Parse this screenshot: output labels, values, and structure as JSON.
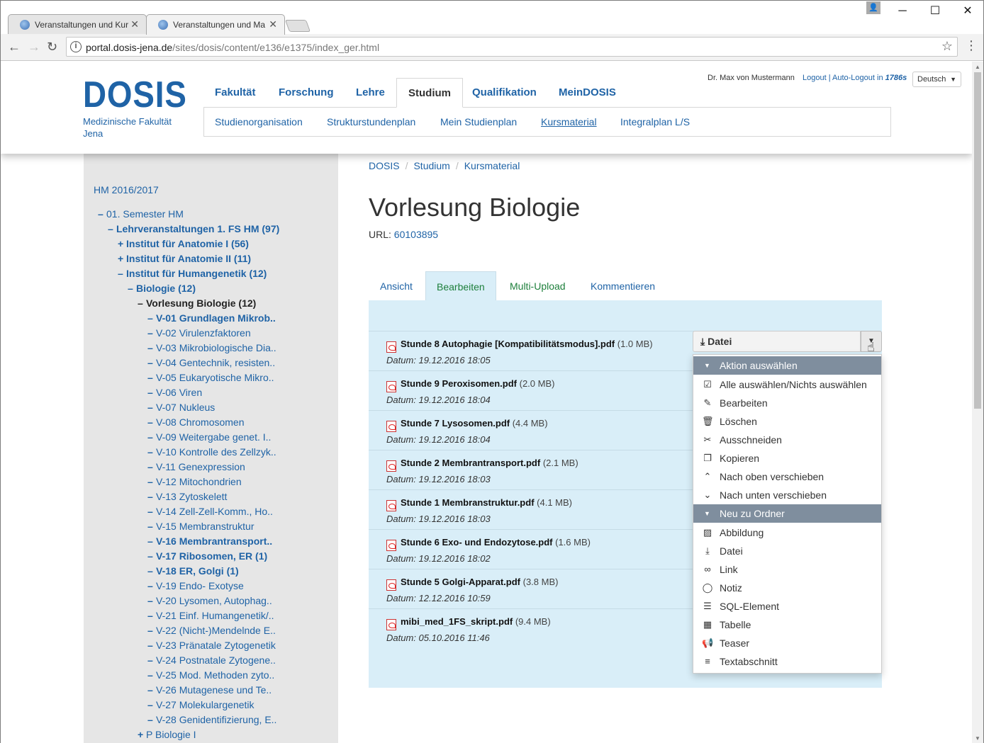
{
  "browser": {
    "tabs": [
      {
        "title": "Veranstaltungen und Kur",
        "active": false
      },
      {
        "title": "Veranstaltungen und Ma",
        "active": true
      }
    ],
    "url_host": "portal.dosis-jena.de",
    "url_path": "/sites/dosis/content/e136/e1375/index_ger.html"
  },
  "header": {
    "logo": "DOSIS",
    "logo_sub1": "Medizinische Fakultät",
    "logo_sub2": "Jena",
    "main_nav": [
      "Fakultät",
      "Forschung",
      "Lehre",
      "Studium",
      "Qualifikation",
      "MeinDOSIS"
    ],
    "sub_nav": [
      "Studienorganisation",
      "Strukturstundenplan",
      "Mein Studienplan",
      "Kursmaterial",
      "Integralplan L/S"
    ],
    "user_name": "Dr. Max von Mustermann",
    "logout": "Logout | Auto-Logout in",
    "logout_seconds": "1786s",
    "language": "Deutsch"
  },
  "sidebar": {
    "year": "HM 2016/2017",
    "tree": [
      {
        "sign": "–",
        "label": "01. Semester HM",
        "level": 0,
        "bold": false
      },
      {
        "sign": "–",
        "label": "Lehrveranstaltungen 1. FS HM (97)",
        "level": 1,
        "bold": true
      },
      {
        "sign": "+",
        "label": "Institut für Anatomie I (56)",
        "level": 2,
        "bold": true
      },
      {
        "sign": "+",
        "label": "Institut für Anatomie II (11)",
        "level": 2,
        "bold": true
      },
      {
        "sign": "–",
        "label": "Institut für Humangenetik (12)",
        "level": 2,
        "bold": true
      },
      {
        "sign": "–",
        "label": "Biologie (12)",
        "level": 3,
        "bold": true
      },
      {
        "sign": "–",
        "label": "Vorlesung Biologie (12)",
        "level": 4,
        "bold": true,
        "current": true
      },
      {
        "sign": "–",
        "label": "V-01 Grundlagen Mikrob..",
        "level": 5,
        "bold": true
      },
      {
        "sign": "–",
        "label": "V-02 Virulenzfaktoren",
        "level": 5,
        "bold": false
      },
      {
        "sign": "–",
        "label": "V-03 Mikrobiologische Dia..",
        "level": 5,
        "bold": false
      },
      {
        "sign": "–",
        "label": "V-04 Gentechnik, resisten..",
        "level": 5,
        "bold": false
      },
      {
        "sign": "–",
        "label": "V-05 Eukaryotische Mikro..",
        "level": 5,
        "bold": false
      },
      {
        "sign": "–",
        "label": "V-06 Viren",
        "level": 5,
        "bold": false
      },
      {
        "sign": "–",
        "label": "V-07 Nukleus",
        "level": 5,
        "bold": false
      },
      {
        "sign": "–",
        "label": "V-08 Chromosomen",
        "level": 5,
        "bold": false
      },
      {
        "sign": "–",
        "label": "V-09 Weitergabe genet. I..",
        "level": 5,
        "bold": false
      },
      {
        "sign": "–",
        "label": "V-10 Kontrolle des Zellzyk..",
        "level": 5,
        "bold": false
      },
      {
        "sign": "–",
        "label": "V-11 Genexpression",
        "level": 5,
        "bold": false
      },
      {
        "sign": "–",
        "label": "V-12 Mitochondrien",
        "level": 5,
        "bold": false
      },
      {
        "sign": "–",
        "label": "V-13 Zytoskelett",
        "level": 5,
        "bold": false
      },
      {
        "sign": "–",
        "label": "V-14 Zell-Zell-Komm., Ho..",
        "level": 5,
        "bold": false
      },
      {
        "sign": "–",
        "label": "V-15 Membranstruktur",
        "level": 5,
        "bold": false
      },
      {
        "sign": "–",
        "label": "V-16 Membrantransport..",
        "level": 5,
        "bold": true
      },
      {
        "sign": "–",
        "label": "V-17 Ribosomen, ER (1)",
        "level": 5,
        "bold": true
      },
      {
        "sign": "–",
        "label": "V-18 ER, Golgi (1)",
        "level": 5,
        "bold": true
      },
      {
        "sign": "–",
        "label": "V-19 Endo- Exotyse",
        "level": 5,
        "bold": false
      },
      {
        "sign": "–",
        "label": "V-20 Lysomen, Autophag..",
        "level": 5,
        "bold": false
      },
      {
        "sign": "–",
        "label": "V-21 Einf. Humangenetik/..",
        "level": 5,
        "bold": false
      },
      {
        "sign": "–",
        "label": "V-22 (Nicht-)Mendelnde E..",
        "level": 5,
        "bold": false
      },
      {
        "sign": "–",
        "label": "V-23 Pränatale Zytogenetik",
        "level": 5,
        "bold": false
      },
      {
        "sign": "–",
        "label": "V-24 Postnatale Zytogene..",
        "level": 5,
        "bold": false
      },
      {
        "sign": "–",
        "label": "V-25 Mod. Methoden zyto..",
        "level": 5,
        "bold": false
      },
      {
        "sign": "–",
        "label": "V-26 Mutagenese und Te..",
        "level": 5,
        "bold": false
      },
      {
        "sign": "–",
        "label": "V-27 Molekulargenetik",
        "level": 5,
        "bold": false
      },
      {
        "sign": "–",
        "label": "V-28 Genidentifizierung, E..",
        "level": 5,
        "bold": false
      },
      {
        "sign": "+",
        "label": "P Biologie I",
        "level": 4,
        "bold": false
      }
    ]
  },
  "main": {
    "breadcrumb": [
      "DOSIS",
      "Studium",
      "Kursmaterial"
    ],
    "title": "Vorlesung Biologie",
    "url_label": "URL:",
    "url_value": "60103895",
    "tabs": [
      "Ansicht",
      "Bearbeiten",
      "Multi-Upload",
      "Kommentieren"
    ],
    "active_tab": "Bearbeiten",
    "date_label": "Datum:",
    "files": [
      {
        "name": "Stunde 8 Autophagie [Kompatibilitätsmodus].pdf",
        "size": "(1.0 MB)",
        "date": "19.12.2016 18:05"
      },
      {
        "name": "Stunde 9 Peroxisomen.pdf",
        "size": "(2.0 MB)",
        "date": "19.12.2016 18:04"
      },
      {
        "name": "Stunde 7 Lysosomen.pdf",
        "size": "(4.4 MB)",
        "date": "19.12.2016 18:04"
      },
      {
        "name": "Stunde 2 Membrantransport.pdf",
        "size": "(2.1 MB)",
        "date": "19.12.2016 18:03"
      },
      {
        "name": "Stunde 1 Membranstruktur.pdf",
        "size": "(4.1 MB)",
        "date": "19.12.2016 18:03"
      },
      {
        "name": "Stunde 6 Exo- und Endozytose.pdf",
        "size": "(1.6 MB)",
        "date": "19.12.2016 18:02"
      },
      {
        "name": "Stunde 5 Golgi-Apparat.pdf",
        "size": "(3.8 MB)",
        "date": "12.12.2016 10:59"
      },
      {
        "name": "mibi_med_1FS_skript.pdf",
        "size": "(9.4 MB)",
        "date": "05.10.2016 11:46"
      }
    ]
  },
  "dropdown": {
    "button_label": "Datei",
    "group1": "Aktion auswählen",
    "actions": [
      {
        "label": "Alle auswählen/Nichts auswählen",
        "icon": "check-square-icon",
        "glyph": "☑"
      },
      {
        "label": "Bearbeiten",
        "icon": "edit-icon",
        "glyph": "✎"
      },
      {
        "label": "Löschen",
        "icon": "trash-icon",
        "glyph": "🗑"
      },
      {
        "label": "Ausschneiden",
        "icon": "scissors-icon",
        "glyph": "✂"
      },
      {
        "label": "Kopieren",
        "icon": "copy-icon",
        "glyph": "❐"
      },
      {
        "label": "Nach oben verschieben",
        "icon": "chevron-double-up-icon",
        "glyph": "⌃"
      },
      {
        "label": "Nach unten verschieben",
        "icon": "chevron-double-down-icon",
        "glyph": "⌄"
      }
    ],
    "group2": "Neu zu Ordner",
    "new_items": [
      {
        "label": "Abbildung",
        "icon": "image-icon",
        "glyph": "▨"
      },
      {
        "label": "Datei",
        "icon": "download-icon",
        "glyph": "⤓"
      },
      {
        "label": "Link",
        "icon": "link-icon",
        "glyph": "∞"
      },
      {
        "label": "Notiz",
        "icon": "comment-icon",
        "glyph": "◯"
      },
      {
        "label": "SQL-Element",
        "icon": "list-icon",
        "glyph": "☰"
      },
      {
        "label": "Tabelle",
        "icon": "table-icon",
        "glyph": "▦"
      },
      {
        "label": "Teaser",
        "icon": "bullhorn-icon",
        "glyph": "📢"
      },
      {
        "label": "Textabschnitt",
        "icon": "align-left-icon",
        "glyph": "≡"
      }
    ]
  },
  "colors": {
    "brand": "#1f63a6",
    "panel": "#d9eef8",
    "menu_group": "#7f8e9e",
    "active_tab_text": "#1d7f3b"
  }
}
